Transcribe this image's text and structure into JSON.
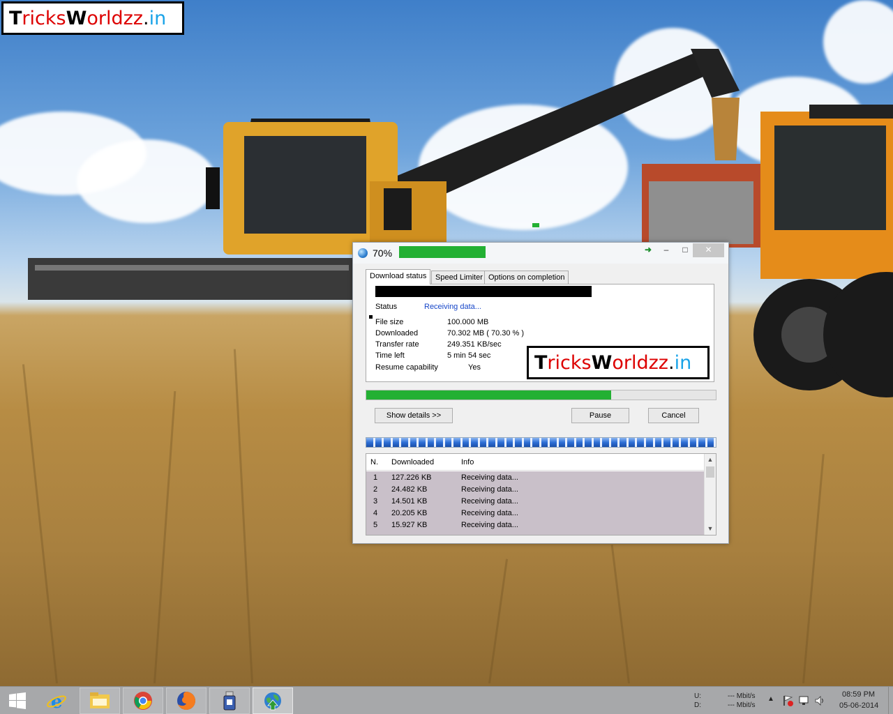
{
  "watermark": {
    "b1": "T",
    "r1": "ricks",
    "b2": "W",
    "r2": "orldzz",
    "dot": ".",
    "in": "in"
  },
  "download": {
    "title": "70%",
    "tabs": [
      "Download status",
      "Speed Limiter",
      "Options on completion"
    ],
    "status_label": "Status",
    "status_value": "Receiving data...",
    "file_size_label": "File size",
    "file_size_value": "100.000  MB",
    "downloaded_label": "Downloaded",
    "downloaded_value": "70.302  MB  ( 70.30 % )",
    "transfer_rate_label": "Transfer rate",
    "transfer_rate_value": "249.351  KB/sec",
    "time_left_label": "Time left",
    "time_left_value": "5 min 54 sec",
    "resume_label": "Resume capability",
    "resume_value": "Yes",
    "progress_fraction": 0.7,
    "buttons": {
      "show_details": "Show details >>",
      "pause": "Pause",
      "cancel": "Cancel"
    },
    "connections": {
      "headers": [
        "N.",
        "Downloaded",
        "Info"
      ],
      "rows": [
        {
          "n": "1",
          "downloaded": "127.226  KB",
          "info": "Receiving data..."
        },
        {
          "n": "2",
          "downloaded": "24.482  KB",
          "info": "Receiving data..."
        },
        {
          "n": "3",
          "downloaded": "14.501  KB",
          "info": "Receiving data..."
        },
        {
          "n": "4",
          "downloaded": "20.205  KB",
          "info": "Receiving data..."
        },
        {
          "n": "5",
          "downloaded": "15.927  KB",
          "info": "Receiving data..."
        }
      ]
    },
    "window_buttons": {
      "minimize": "–",
      "maximize": "□",
      "close": "✕",
      "tray": "➜"
    }
  },
  "taskbar": {
    "net_label_u": "U:",
    "net_label_d": "D:",
    "net_up": "--- Mbit/s",
    "net_down": "--- Mbit/s",
    "time": "08:59 PM",
    "date": "05-06-2014",
    "apps": [
      "start-button",
      "internet-explorer",
      "file-explorer",
      "chrome",
      "firefox",
      "usb-app",
      "idm"
    ]
  },
  "colors": {
    "progress": "#23b033",
    "status_link": "#1646c8",
    "logo_red": "#dd0000",
    "logo_blue": "#1aa3e8"
  }
}
